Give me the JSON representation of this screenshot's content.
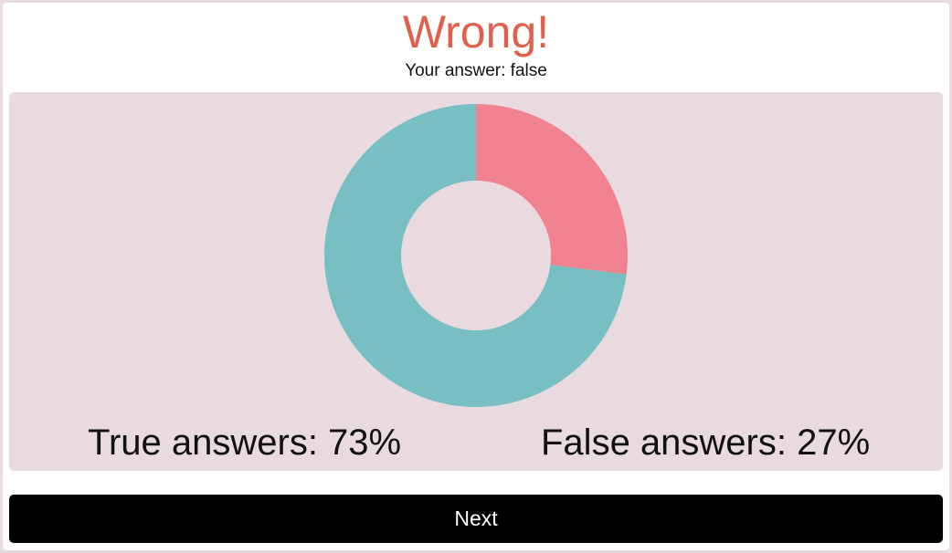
{
  "result": {
    "title": "Wrong!",
    "your_answer": "Your answer: false"
  },
  "colors": {
    "title": "#e0604e",
    "true_segment": "#77bfc3",
    "false_segment": "#f0838f",
    "panel_background": "#e8dade",
    "button_background": "#000000"
  },
  "chart_data": {
    "type": "pie",
    "variant": "donut",
    "categories": [
      "True",
      "False"
    ],
    "values": [
      73,
      27
    ],
    "unit": "%",
    "colors": [
      "#77bfc3",
      "#f0838f"
    ]
  },
  "stats": {
    "true_label": "True answers: 73%",
    "false_label": "False answers: 27%"
  },
  "actions": {
    "next_label": "Next"
  }
}
